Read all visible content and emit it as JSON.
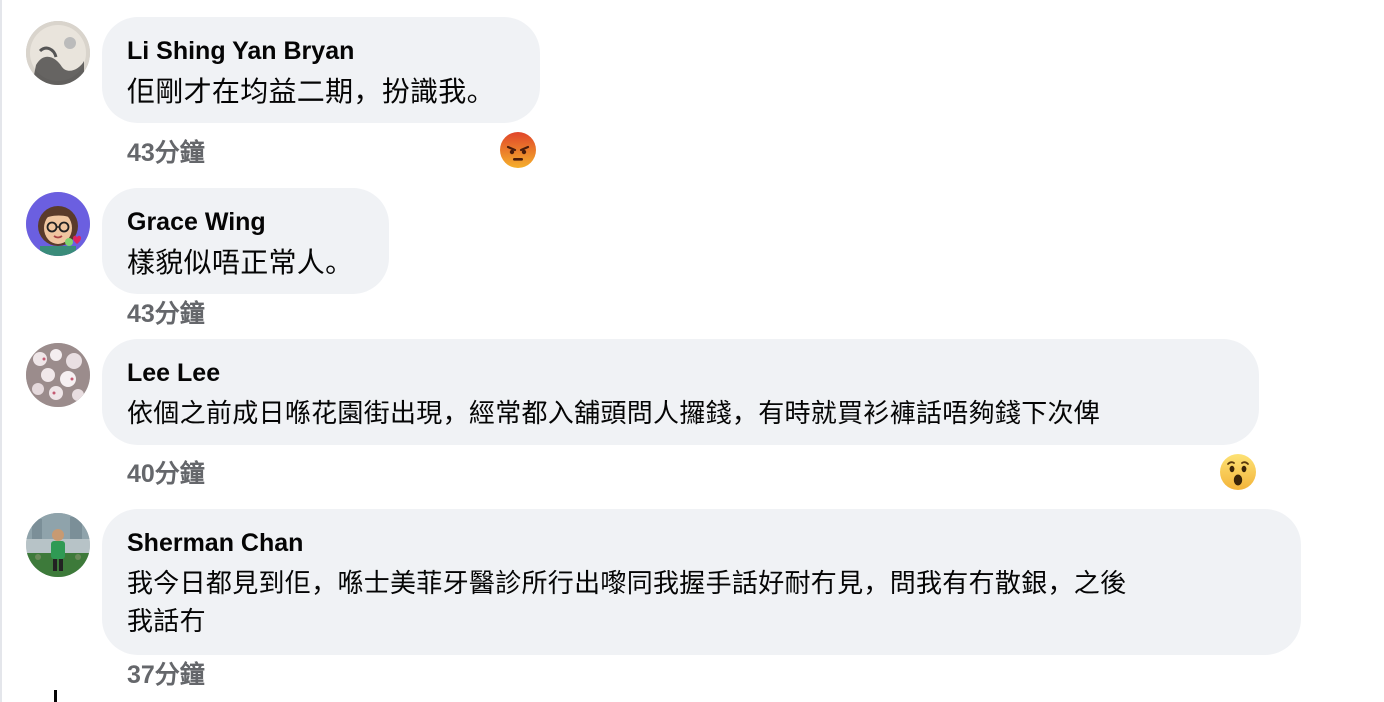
{
  "comments": [
    {
      "author": "Li Shing Yan Bryan",
      "text": "佢剛才在均益二期，扮識我。",
      "time": "43分鐘",
      "reaction": "angry-emoji"
    },
    {
      "author": "Grace Wing",
      "text": "樣貌似唔正常人。",
      "time": "43分鐘",
      "reaction": null
    },
    {
      "author": "Lee Lee",
      "text": "依個之前成日喺花園街出現，經常都入舖頭問人攞錢，有時就買衫褲話唔夠錢下次俾",
      "time": "40分鐘",
      "reaction": "wow-emoji"
    },
    {
      "author": "Sherman Chan",
      "text_line1": "我今日都見到佢，喺士美菲牙醫診所行出嚟同我握手話好耐冇見，問我有冇散銀，之後",
      "text_line2": "我話冇",
      "time": "37分鐘",
      "reaction": null
    }
  ],
  "colors": {
    "bubble": "#f0f2f5",
    "author": "#050505",
    "time": "#65676b"
  }
}
